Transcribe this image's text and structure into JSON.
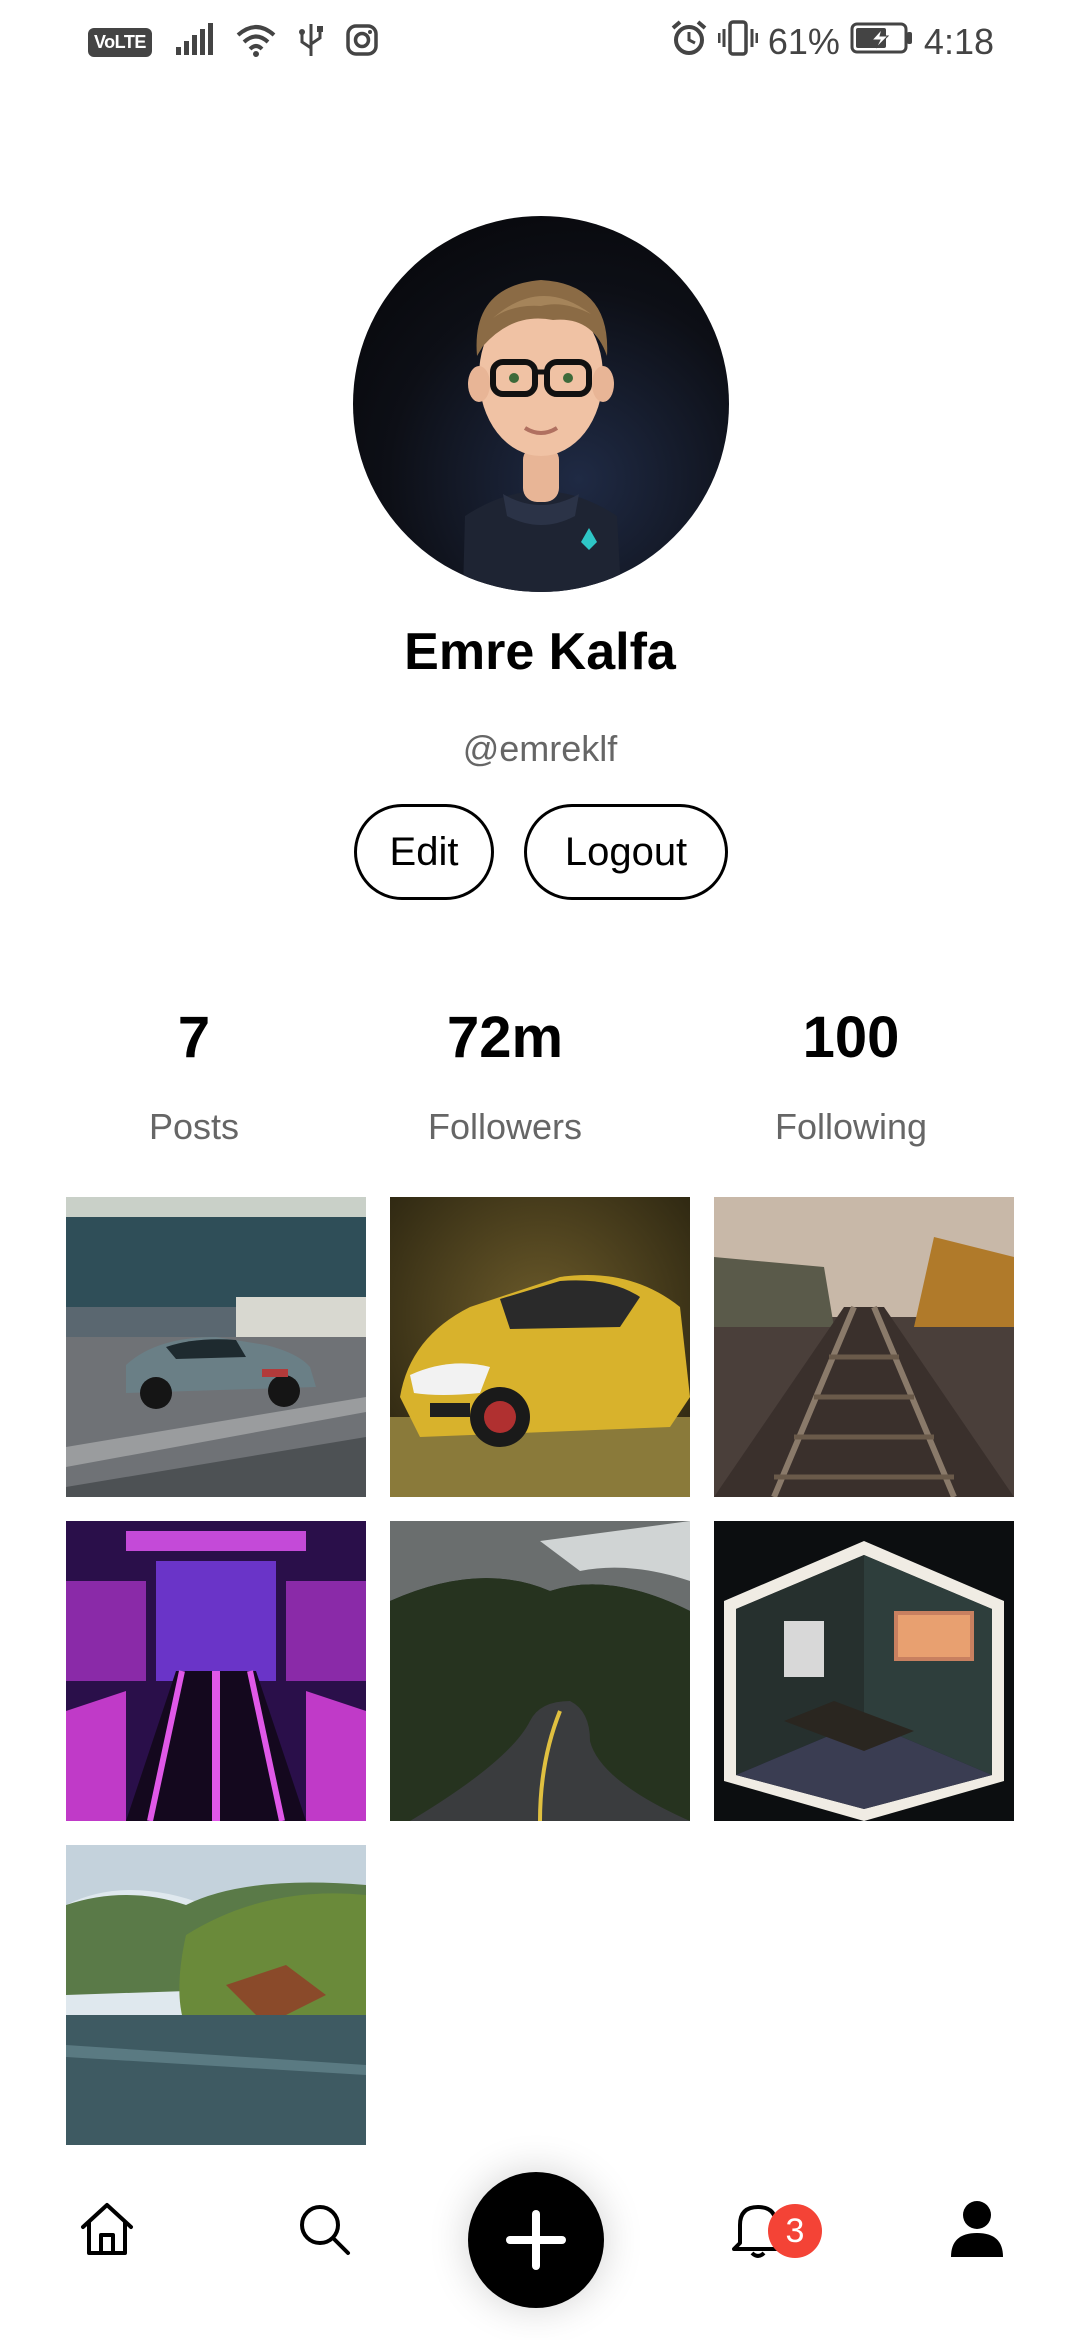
{
  "status_bar": {
    "network_label": "VoLTE",
    "battery_percent": "61%",
    "time": "4:18"
  },
  "profile": {
    "name": "Emre Kalfa",
    "handle": "@emreklf",
    "edit_label": "Edit",
    "logout_label": "Logout"
  },
  "stats": [
    {
      "value": "7",
      "label": "Posts"
    },
    {
      "value": "72m",
      "label": "Followers"
    },
    {
      "value": "100",
      "label": "Following"
    }
  ],
  "posts": [
    {
      "subject": "silver sports car on road",
      "icon": "car-photo"
    },
    {
      "subject": "yellow hatchback car",
      "icon": "car-photo"
    },
    {
      "subject": "railway tracks in fog",
      "icon": "railway-photo"
    },
    {
      "subject": "neon purple escalator",
      "icon": "escalator-photo"
    },
    {
      "subject": "mountain road",
      "icon": "road-photo"
    },
    {
      "subject": "isometric room",
      "icon": "room-photo"
    },
    {
      "subject": "lake with forest hills",
      "icon": "lake-photo"
    }
  ],
  "bottom_nav": {
    "notification_count": "3"
  },
  "colors": {
    "accent": "#000000",
    "badge": "#f44336",
    "secondary_text": "#666666"
  }
}
